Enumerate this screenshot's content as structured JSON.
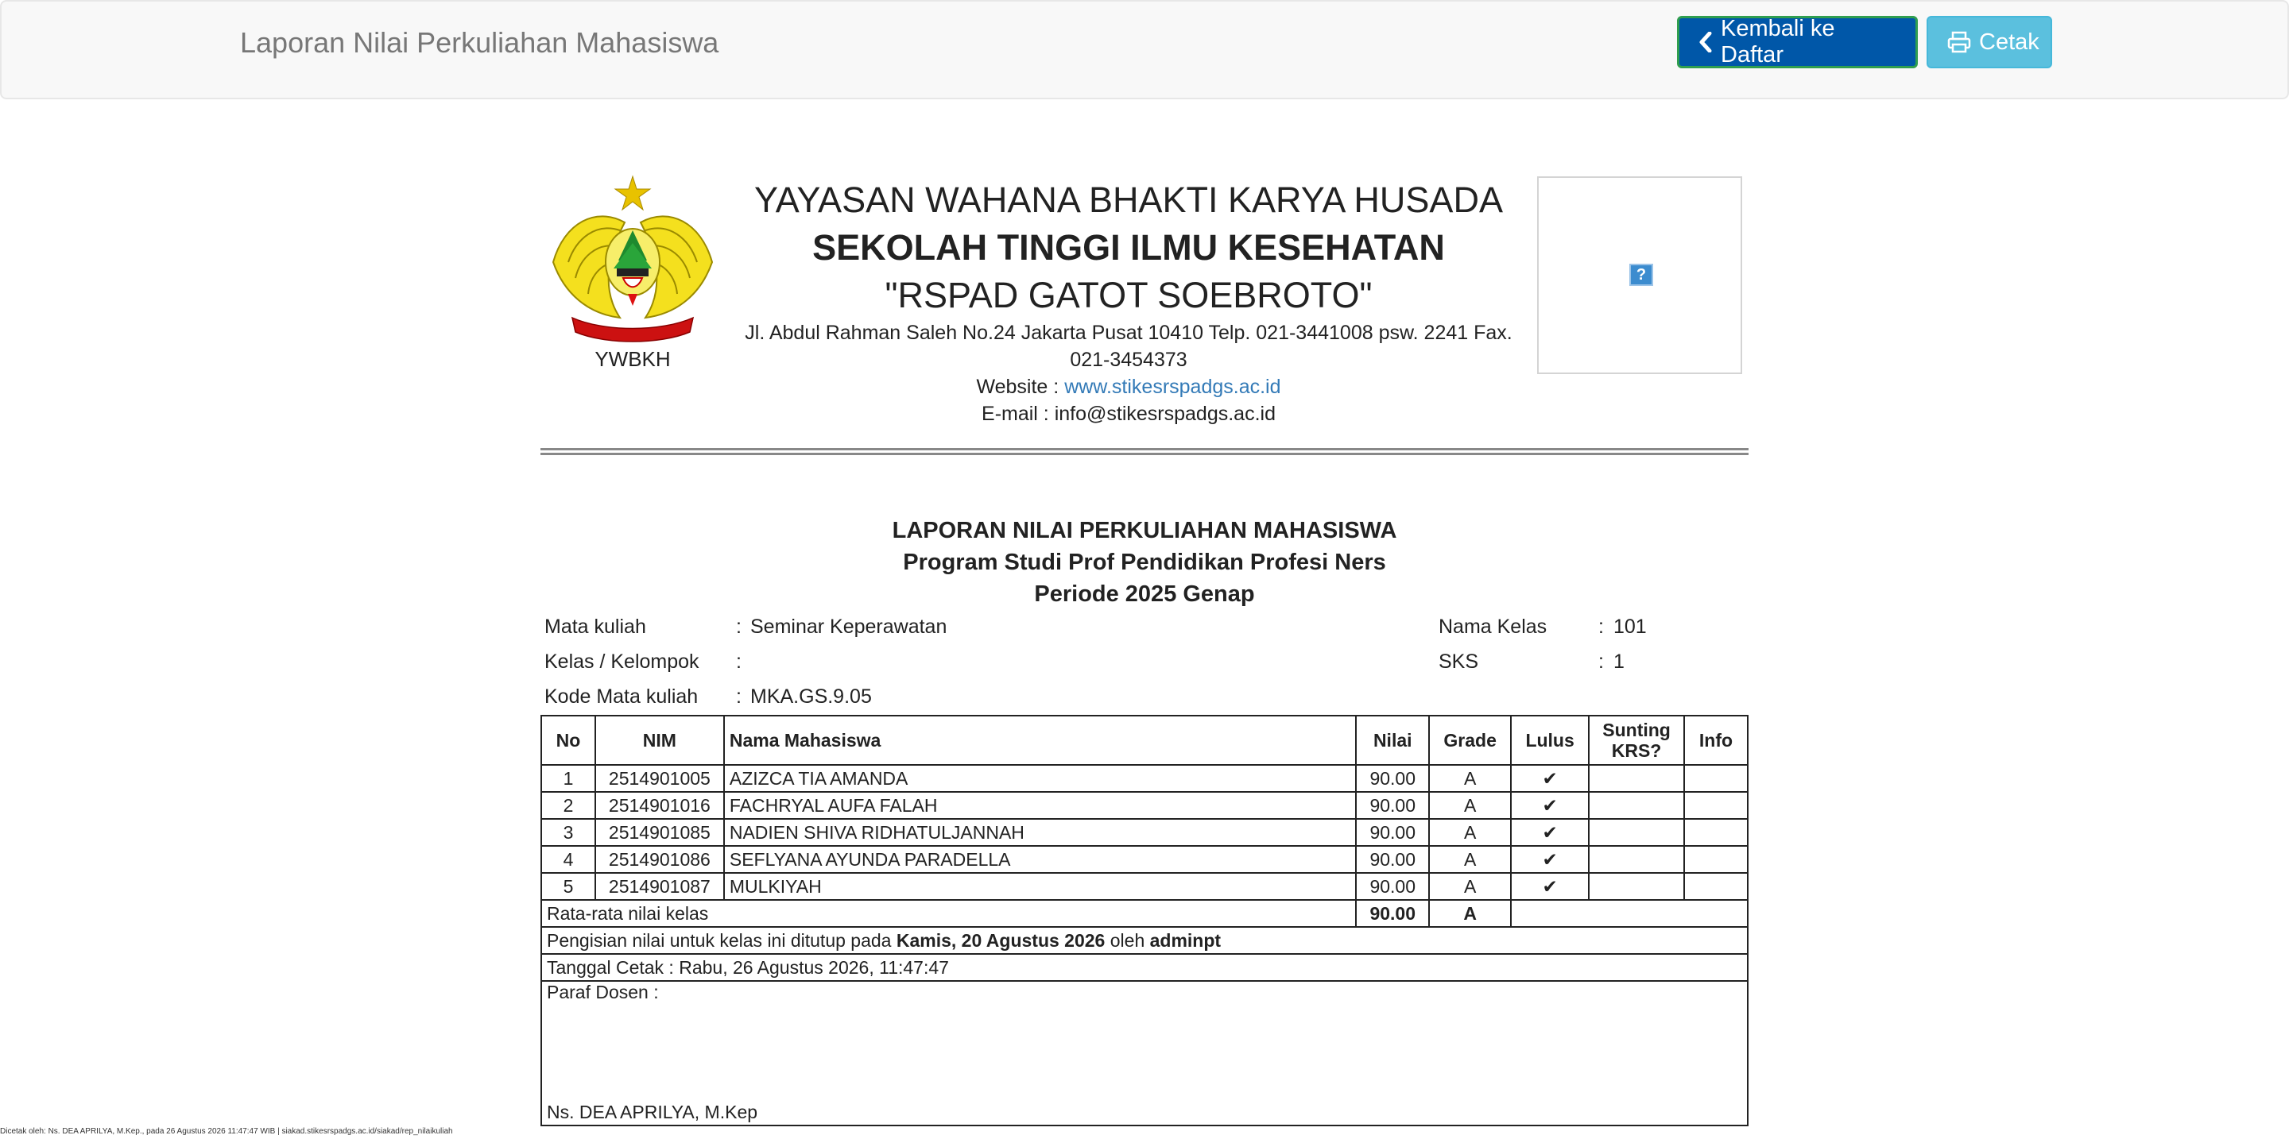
{
  "navbar": {
    "title": "Laporan Nilai Perkuliahan Mahasiswa",
    "back_button": "Kembali ke Daftar",
    "back_icon": "chevron-left-icon",
    "print_button": "Cetak",
    "print_icon": "printer-icon"
  },
  "letterhead": {
    "logo_caption": "YWBKH",
    "line1": "YAYASAN WAHANA BHAKTI KARYA HUSADA",
    "line2": "SEKOLAH TINGGI ILMU KESEHATAN",
    "line3": "\"RSPAD GATOT SOEBROTO\"",
    "address": "Jl. Abdul Rahman Saleh No.24 Jakarta Pusat 10410 Telp. 021-3441008 psw. 2241 Fax. 021-3454373",
    "website_label": "Website : ",
    "website_url": "www.stikesrspadgs.ac.id",
    "email": "E-mail : info@stikesrspadgs.ac.id",
    "photo_placeholder": "?"
  },
  "report": {
    "title1": "LAPORAN NILAI PERKULIAHAN MAHASISWA",
    "title2": "Program Studi Prof Pendidikan Profesi Ners",
    "title3": "Periode 2025 Genap"
  },
  "info": {
    "mata_kuliah_label": "Mata kuliah",
    "mata_kuliah_value": "Seminar Keperawatan",
    "kelas_label": "Kelas / Kelompok",
    "kelas_value": "",
    "kode_label": "Kode Mata kuliah",
    "kode_value": "MKA.GS.9.05",
    "nama_kelas_label": "Nama Kelas",
    "nama_kelas_value": "101",
    "sks_label": "SKS",
    "sks_value": "1",
    "sep": ":"
  },
  "table": {
    "headers": [
      "No",
      "NIM",
      "Nama Mahasiswa",
      "Nilai",
      "Grade",
      "Lulus",
      "Sunting KRS?",
      "Info"
    ],
    "rows": [
      {
        "no": "1",
        "nim": "2514901005",
        "nama": "AZIZCA TIA AMANDA",
        "nilai": "90.00",
        "grade": "A",
        "lulus": "✔"
      },
      {
        "no": "2",
        "nim": "2514901016",
        "nama": "FACHRYAL AUFA FALAH",
        "nilai": "90.00",
        "grade": "A",
        "lulus": "✔"
      },
      {
        "no": "3",
        "nim": "2514901085",
        "nama": "NADIEN SHIVA RIDHATULJANNAH",
        "nilai": "90.00",
        "grade": "A",
        "lulus": "✔"
      },
      {
        "no": "4",
        "nim": "2514901086",
        "nama": "SEFLYANA AYUNDA PARADELLA",
        "nilai": "90.00",
        "grade": "A",
        "lulus": "✔"
      },
      {
        "no": "5",
        "nim": "2514901087",
        "nama": "MULKIYAH",
        "nilai": "90.00",
        "grade": "A",
        "lulus": "✔"
      }
    ],
    "avg_label": "Rata-rata nilai kelas",
    "avg_value": "90.00",
    "avg_grade": "A",
    "closed_prefix": "Pengisian nilai untuk kelas ini ditutup pada ",
    "closed_date": "Kamis, 20 Agustus 2026",
    "closed_mid": " oleh ",
    "closed_by": "adminpt",
    "print_date": "Tanggal Cetak : Rabu, 26 Agustus 2026, 11:47:47",
    "paraf_label": "Paraf Dosen :",
    "dosen_name": "Ns. DEA APRILYA, M.Kep"
  },
  "footer": {
    "printed_by": "Dicetak oleh: Ns. DEA APRILYA, M.Kep., pada 26 Agustus 2026 11:47:47 WIB | siakad.stikesrspadgs.ac.id/siakad/rep_nilaikuliah"
  }
}
